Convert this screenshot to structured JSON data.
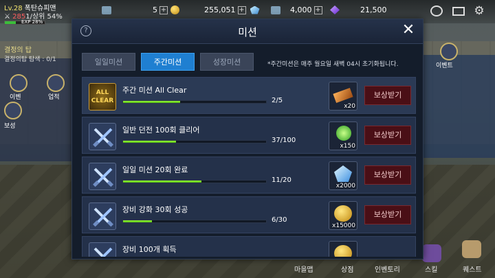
{
  "hud": {
    "level": "Lv.28",
    "name": "폭탄슈피맨",
    "rank_value": "285",
    "rank_text": "1/상위 54%",
    "exp_label": "EXP 28%",
    "exp_progress": 0.28,
    "stamina": "5",
    "gold": "255,051",
    "gems": "4,000",
    "crystals": "21,500"
  },
  "quest": {
    "title": "결정의 탑",
    "progress": "결정의탑 탐색 : 0/1"
  },
  "side_labels": {
    "left_a": "이벤",
    "left_b": "업적",
    "left_c": "보성",
    "right_a": "이벤트"
  },
  "bottom_menu": [
    "마을맵",
    "상점",
    "인벤토리",
    "스킬",
    "퀘스트"
  ],
  "dialog": {
    "title": "미션",
    "help_icon": "?",
    "close_icon": "✕",
    "tabs": [
      "일일미션",
      "주간미션",
      "성장미션"
    ],
    "active_tab": 1,
    "notice": "*주간미션은 매주 월요일 새벽 04시 초기화됩니다.",
    "claim_label": "보상받기",
    "all_clear_badge_top": "ALL",
    "all_clear_badge_bottom": "CLEAR",
    "missions": [
      {
        "title": "주간 미션 All Clear",
        "count": "2/5",
        "progress": 0.4,
        "reward_qty": "x20",
        "reward_icon": "ticket-icon",
        "icon": "all-clear-icon"
      },
      {
        "title": "일반 던전 100회 클리어",
        "count": "37/100",
        "progress": 0.37,
        "reward_qty": "x150",
        "reward_icon": "green-gem-icon",
        "icon": "crossed-swords-icon"
      },
      {
        "title": "일일 미션 20회 완료",
        "count": "11/20",
        "progress": 0.55,
        "reward_qty": "x2000",
        "reward_icon": "blue-crystal-icon",
        "icon": "crossed-swords-icon"
      },
      {
        "title": "장비 강화 30회 성공",
        "count": "6/30",
        "progress": 0.2,
        "reward_qty": "x15000",
        "reward_icon": "gold-coins-icon",
        "icon": "crossed-swords-icon"
      },
      {
        "title": "장비 100개 획득",
        "count": "",
        "progress": 0,
        "reward_qty": "",
        "reward_icon": "gold-coins-icon",
        "icon": "crossed-swords-icon"
      }
    ]
  },
  "colors": {
    "accent_tab": "#1f7fd1",
    "progress": "#7fe020",
    "claim_bg": "#4a0f16"
  }
}
